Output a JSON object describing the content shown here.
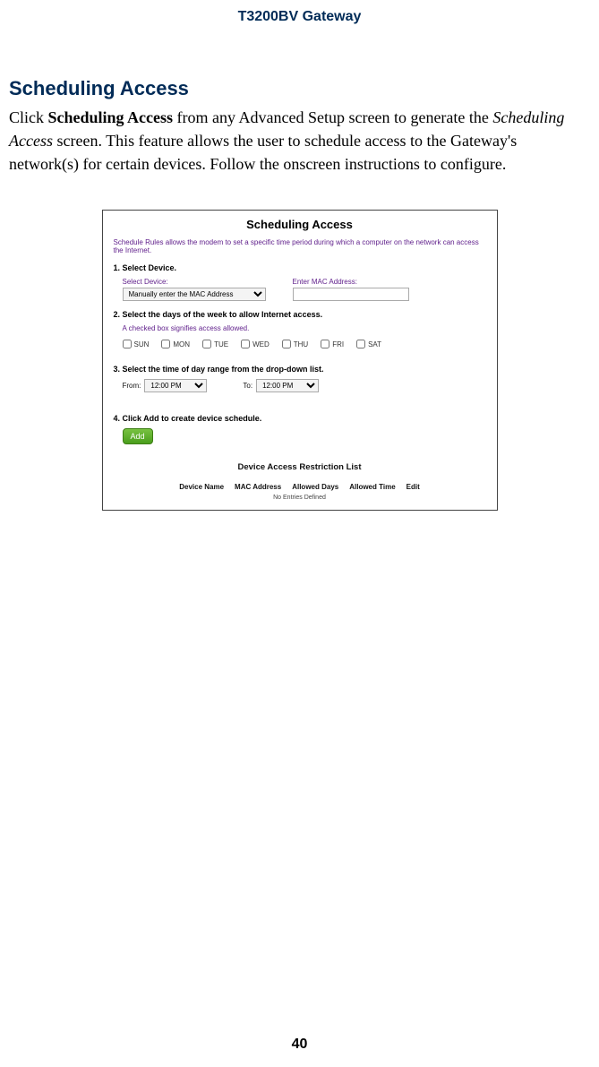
{
  "header": {
    "product": "T3200BV Gateway"
  },
  "section": {
    "heading": "Scheduling Access",
    "para_a": "Click ",
    "para_bold": "Scheduling Access",
    "para_b": " from any Advanced Setup screen to generate the ",
    "para_italic": "Scheduling Access",
    "para_c": " screen. This feature allows the user to schedule access to the Gateway's network(s) for certain devices. Follow the onscreen instructions to configure."
  },
  "screenshot": {
    "title": "Scheduling Access",
    "intro": "Schedule Rules allows the modem to set a specific time period during which a computer on the network can access the Internet.",
    "step1": "1. Select Device.",
    "select_device_label": "Select Device:",
    "select_device_value": "Manually enter the MAC Address",
    "enter_mac_label": "Enter MAC Address:",
    "enter_mac_value": "",
    "step2": "2. Select the days of the week to allow Internet access.",
    "step2_hint": "A checked box signifies access allowed.",
    "days": [
      "SUN",
      "MON",
      "TUE",
      "WED",
      "THU",
      "FRI",
      "SAT"
    ],
    "step3": "3. Select the time of day range from the drop-down list.",
    "from_label": "From:",
    "from_value": "12:00 PM",
    "to_label": "To:",
    "to_value": "12:00 PM",
    "step4": "4. Click Add to create device schedule.",
    "add_label": "Add",
    "list_title": "Device Access Restriction List",
    "cols": [
      "Device Name",
      "MAC Address",
      "Allowed Days",
      "Allowed Time",
      "Edit"
    ],
    "empty": "No Entries Defined"
  },
  "page_number": "40"
}
